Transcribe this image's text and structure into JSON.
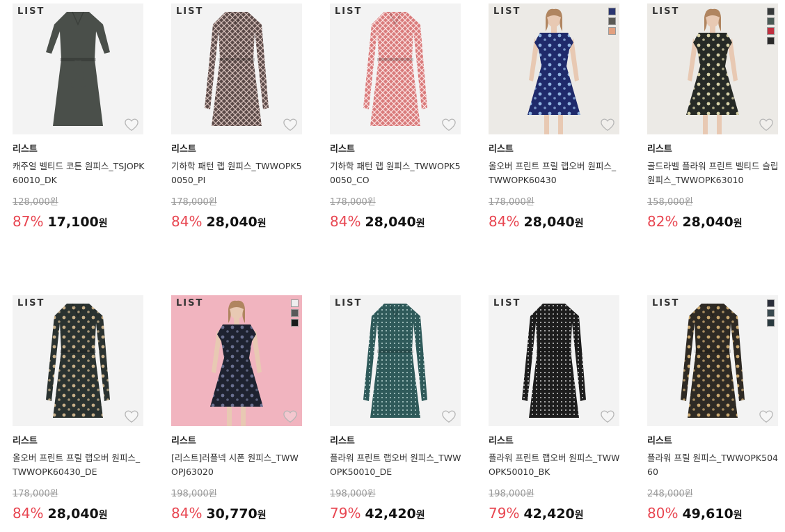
{
  "products": [
    {
      "logo": "LIST",
      "brand": "리스트",
      "name": "캐주얼 벨티드 코튼 원피스_TSJOPK60010_DK",
      "original_price": "128,000원",
      "discount": "87%",
      "price": "17,100",
      "currency": "원",
      "image": {
        "bg": "#f3f3f3",
        "dress": "#4a4f4a",
        "pattern": "solid",
        "model": false
      },
      "swatches": []
    },
    {
      "logo": "LIST",
      "brand": "리스트",
      "name": "기하학 패턴 랩 원피스_TWWOPK50050_PI",
      "original_price": "178,000원",
      "discount": "84%",
      "price": "28,040",
      "currency": "원",
      "image": {
        "bg": "#f3f3f3",
        "dress": "#5b4a48",
        "pattern": "geo",
        "accent": "#d9c3bd",
        "model": false
      },
      "swatches": []
    },
    {
      "logo": "LIST",
      "brand": "리스트",
      "name": "기하학 패턴 랩 원피스_TWWOPK50050_CO",
      "original_price": "178,000원",
      "discount": "84%",
      "price": "28,040",
      "currency": "원",
      "image": {
        "bg": "#f3f3f3",
        "dress": "#d97b7b",
        "pattern": "geo",
        "accent": "#fbe3e3",
        "model": false
      },
      "swatches": []
    },
    {
      "logo": "LIST",
      "brand": "리스트",
      "name": "올오버 프린트 프릴 랩오버 원피스_TWWOPK60430",
      "original_price": "178,000원",
      "discount": "84%",
      "price": "28,040",
      "currency": "원",
      "image": {
        "bg": "#eceae6",
        "dress": "#1f2a6b",
        "pattern": "floral",
        "accent": "#8fb3e0",
        "model": true
      },
      "swatches": [
        "#2a3570",
        "#5b5a55",
        "#e2a080"
      ]
    },
    {
      "logo": "LIST",
      "brand": "리스트",
      "name": "골드라벨 플라워 프린트 벨티드 슬립 원피스_TWWOPK63010",
      "original_price": "158,000원",
      "discount": "82%",
      "price": "28,040",
      "currency": "원",
      "image": {
        "bg": "#eceae6",
        "dress": "#262a26",
        "pattern": "floral",
        "accent": "#d8d2a8",
        "model": true
      },
      "swatches": [
        "#36393a",
        "#4a5a55",
        "#c03040",
        "#2a2a2a"
      ]
    },
    {
      "logo": "LIST",
      "brand": "리스트",
      "name": "올오버 프린트 프릴 랩오버 원피스_TWWOPK60430_DE",
      "original_price": "178,000원",
      "discount": "84%",
      "price": "28,040",
      "currency": "원",
      "image": {
        "bg": "#f3f3f3",
        "dress": "#2a3230",
        "pattern": "floral",
        "accent": "#c8b08a",
        "model": false
      },
      "swatches": []
    },
    {
      "logo": "LIST",
      "brand": "리스트",
      "name": "[리스트]러플넥 시폰 원피스_TWWOPJ63020",
      "original_price": "198,000원",
      "discount": "84%",
      "price": "30,770",
      "currency": "원",
      "image": {
        "bg": "#f1b4bf",
        "dress": "#1e2230",
        "pattern": "floral",
        "accent": "#6a7090",
        "model": true
      },
      "swatches": [
        "#eeeeee",
        "#5a5a5a",
        "#1a1a1a"
      ]
    },
    {
      "logo": "LIST",
      "brand": "리스트",
      "name": "플라워 프린트 랩오버 원피스_TWWOPK50010_DE",
      "original_price": "198,000원",
      "discount": "79%",
      "price": "42,420",
      "currency": "원",
      "image": {
        "bg": "#f3f3f3",
        "dress": "#2f5a5a",
        "pattern": "dots",
        "accent": "#b8d4d0",
        "model": false
      },
      "swatches": []
    },
    {
      "logo": "LIST",
      "brand": "리스트",
      "name": "플라워 프린트 랩오버 원피스_TWWOPK50010_BK",
      "original_price": "198,000원",
      "discount": "79%",
      "price": "42,420",
      "currency": "원",
      "image": {
        "bg": "#f3f3f3",
        "dress": "#1d1d1d",
        "pattern": "dots",
        "accent": "#cfcfcf",
        "model": false
      },
      "swatches": []
    },
    {
      "logo": "LIST",
      "brand": "리스트",
      "name": "플라워 프릴 원피스_TWWOPK50460",
      "original_price": "248,000원",
      "discount": "80%",
      "price": "49,610",
      "currency": "원",
      "image": {
        "bg": "#f3f3f3",
        "dress": "#2e2a24",
        "pattern": "floral",
        "accent": "#c9a870",
        "model": false
      },
      "swatches": [
        "#2a2e3a",
        "#3a4a50",
        "#2a3a40"
      ]
    }
  ]
}
